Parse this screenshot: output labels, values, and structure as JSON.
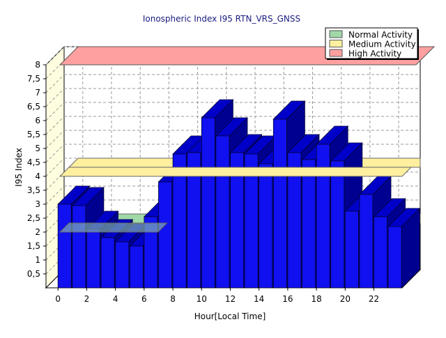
{
  "chart_data": {
    "type": "bar",
    "title": "Ionospheric Index I95 RTN_VRS_GNSS",
    "xlabel": "Hour[Local Time]",
    "ylabel": "I95 Index",
    "ylim": [
      0,
      8
    ],
    "yticks": [
      0.5,
      1,
      1.5,
      2,
      2.5,
      3,
      3.5,
      4,
      4.5,
      5,
      5.5,
      6,
      6.5,
      7,
      7.5,
      8
    ],
    "ytick_labels": [
      "0,5",
      "1",
      "1,5",
      "2",
      "2,5",
      "3",
      "3,5",
      "4",
      "4,5",
      "5",
      "5,5",
      "6",
      "6,5",
      "7",
      "7,5",
      "8"
    ],
    "xticks": [
      0,
      2,
      4,
      6,
      8,
      10,
      12,
      14,
      16,
      18,
      20,
      22
    ],
    "x": [
      0,
      1,
      2,
      3,
      4,
      5,
      6,
      7,
      8,
      9,
      10,
      11,
      12,
      13,
      14,
      15,
      16,
      17,
      18,
      19,
      20,
      21,
      22,
      23
    ],
    "values": [
      3.0,
      2.95,
      2.1,
      1.8,
      1.65,
      1.5,
      2.55,
      3.8,
      4.8,
      4.85,
      6.1,
      5.45,
      4.85,
      4.8,
      4.45,
      6.05,
      4.85,
      4.6,
      5.15,
      4.55,
      2.75,
      3.35,
      2.55,
      2.2
    ],
    "bar_color": "#1010f0",
    "grid": true,
    "legend_position": "top-right",
    "bands": [
      {
        "name": "Normal Activity",
        "level": 2.0,
        "color": "#a0d8a8"
      },
      {
        "name": "Medium Activity",
        "level": 4.0,
        "color": "#fff0a0"
      },
      {
        "name": "High Activity",
        "level": 8.0,
        "color": "#ffa0a0"
      }
    ]
  }
}
